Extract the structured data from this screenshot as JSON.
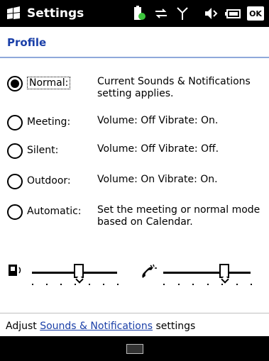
{
  "titlebar": {
    "title": "Settings",
    "ok_label": "OK",
    "icons": [
      "start-logo-icon",
      "battery-charging-icon",
      "sync-arrows-icon",
      "signal-strength-icon",
      "speaker-icon",
      "battery-icon"
    ]
  },
  "section": {
    "header": "Profile"
  },
  "profiles": [
    {
      "label": "Normal:",
      "description": "Current Sounds & Notifications setting applies.",
      "selected": true
    },
    {
      "label": "Meeting:",
      "description": "Volume: Off Vibrate: On.",
      "selected": false
    },
    {
      "label": "Silent:",
      "description": "Volume: Off Vibrate: Off.",
      "selected": false
    },
    {
      "label": "Outdoor:",
      "description": "Volume: On Vibrate: On.",
      "selected": false
    },
    {
      "label": "Automatic:",
      "description": "Set the meeting or normal mode based on Calendar.",
      "selected": false
    }
  ],
  "sliders": {
    "system_volume_level": 0.55,
    "ring_volume_level": 0.7
  },
  "footer": {
    "prefix": "Adjust ",
    "link": "Sounds & Notifications",
    "suffix": " settings"
  }
}
